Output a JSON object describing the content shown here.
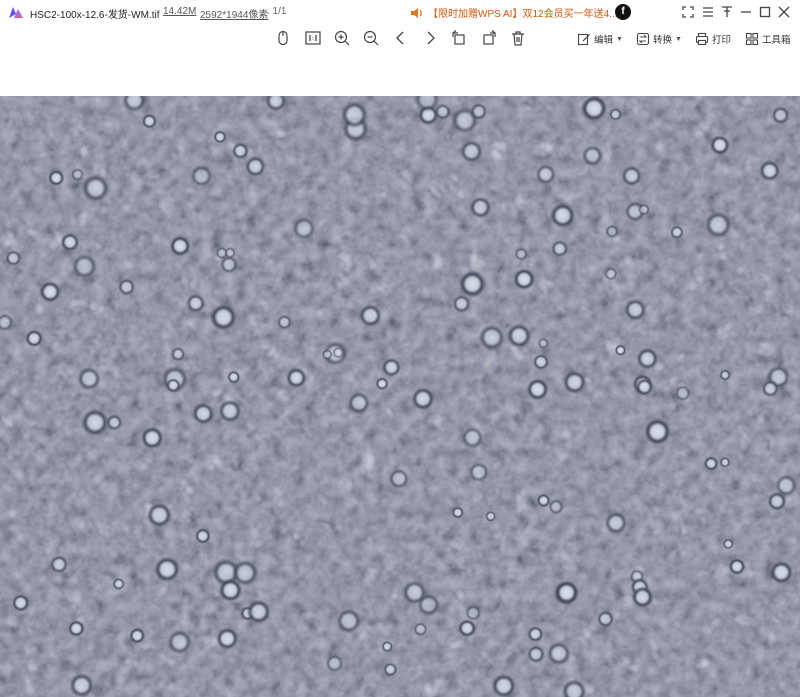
{
  "titlebar": {
    "file_name": "HSC2-100x-12.6-发货-WM.tif",
    "file_size": "14.42M",
    "resolution": "2592*1944像素",
    "page_count": ". 1/1",
    "promo_text": "【限时加赠WPS AI】双12会员买一年送4...",
    "avatar_letter": "f"
  },
  "toolbar": {
    "edit_label": "编辑",
    "convert_label": "转换",
    "print_label": "打印",
    "tools_label": "工具箱"
  },
  "colors": {
    "brand": "#6c4cf5",
    "promo": "#d9560b",
    "icon": "#444444",
    "image_bg": "#525866"
  },
  "icons": {
    "logo": "wps-image-logo",
    "speaker": "speaker-icon",
    "toolbar": [
      "mouse-icon",
      "actual-size-icon",
      "zoom-in-icon",
      "zoom-out-icon",
      "previous-icon",
      "next-icon",
      "rotate-left-icon",
      "rotate-right-icon",
      "delete-icon"
    ]
  }
}
